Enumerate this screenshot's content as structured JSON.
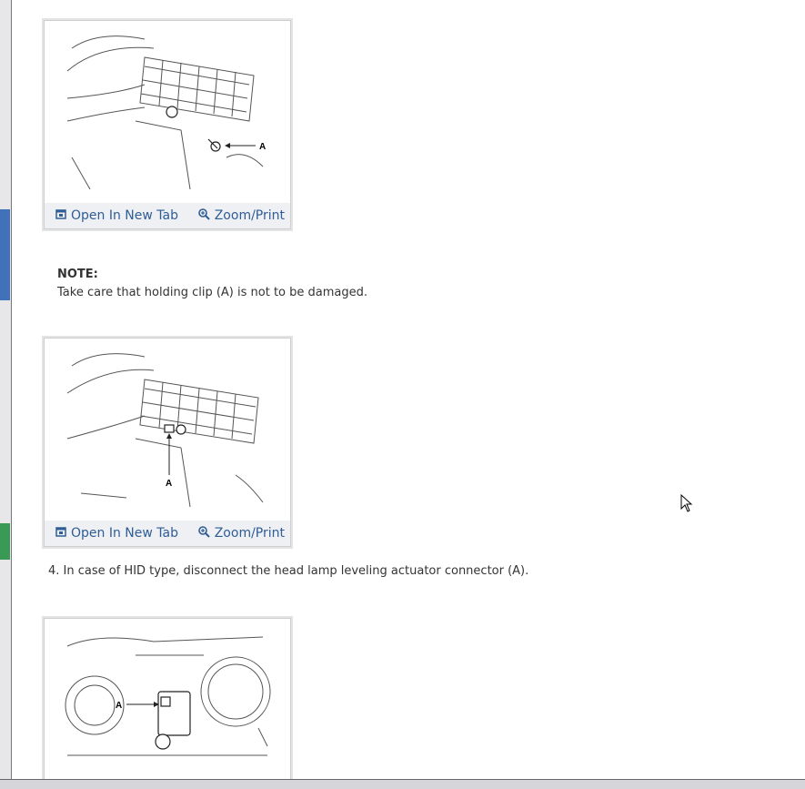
{
  "figures": [
    {
      "open_label": "Open In New Tab",
      "zoom_label": "Zoom/Print",
      "callout": "A"
    },
    {
      "open_label": "Open In New Tab",
      "zoom_label": "Zoom/Print",
      "callout": "A"
    },
    {
      "callout": "A"
    }
  ],
  "note": {
    "heading": "NOTE:",
    "text": "Take care that holding clip (A) is not to be damaged."
  },
  "step4": {
    "text": "4. In case of HID type, disconnect the head lamp leveling actuator connector (A)."
  },
  "colors": {
    "link": "#2f5d95",
    "text": "#333333"
  }
}
